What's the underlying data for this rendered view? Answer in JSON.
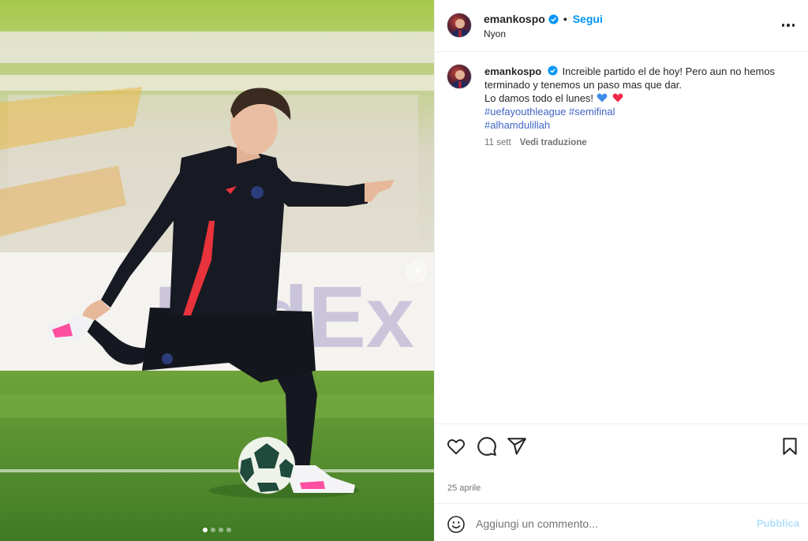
{
  "post": {
    "username": "emankospo",
    "verified": true,
    "follow_label": "Segui",
    "separator": "•",
    "location": "Nyon",
    "more_icon": "more-horizontal-icon"
  },
  "caption": {
    "username": "emankospo",
    "line1": "Increible partido el de hoy! Pero aun no hemos terminado y tenemos un paso mas que dar.",
    "line2": "Lo damos todo el lunes!",
    "emojis": [
      "blue-heart-icon",
      "red-heart-icon"
    ],
    "hashtags": [
      "#uefayouthleague",
      "#semifinal",
      "#alhamdulillah"
    ],
    "time": "11 sett",
    "translate_label": "Vedi traduzione"
  },
  "actions": {
    "icons": [
      "heart-icon",
      "comment-icon",
      "share-icon",
      "bookmark-icon"
    ]
  },
  "post_date": "25 aprile",
  "comment_box": {
    "placeholder": "Aggiungi un commento...",
    "publish_label": "Pubblica"
  },
  "carousel": {
    "total": 4,
    "active_index": 0
  },
  "colors": {
    "accent": "#0095f6",
    "hashtag": "#4064c6",
    "verified": "#0095f6",
    "publish_disabled": "#b2dffc"
  }
}
